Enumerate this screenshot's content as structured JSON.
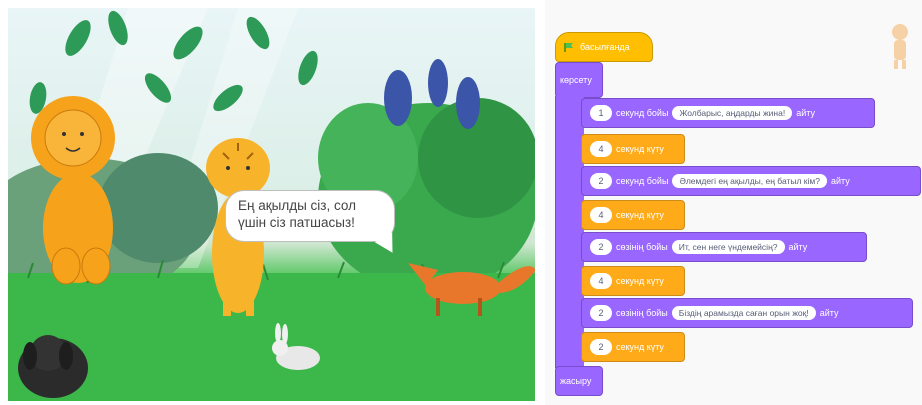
{
  "stage": {
    "bubble_text": "Ең ақылды сіз, сол үшін сіз патшасыз!"
  },
  "code": {
    "hat_label": "басылғанда",
    "say_label_a": "секунд бойы",
    "say_label_b": "сөзінің бойы",
    "say_suffix": "айту",
    "wait_label": "секунд күту",
    "blocks": [
      {
        "type": "repeat",
        "label": "көрсету"
      },
      {
        "type": "say",
        "num": "1",
        "text": "Жолбарыс, аңдарды жина!"
      },
      {
        "type": "wait",
        "num": "4"
      },
      {
        "type": "say",
        "num": "2",
        "text": "Әлемдегі ең ақылды, ең батыл кім?"
      },
      {
        "type": "wait",
        "num": "4"
      },
      {
        "type": "say",
        "num": "2",
        "text": "Ит, сен неге үндемейсің?"
      },
      {
        "type": "wait",
        "num": "4"
      },
      {
        "type": "say",
        "num": "2",
        "text": "Біздің арамызда саған орын жоқ!"
      },
      {
        "type": "wait",
        "num": "2"
      },
      {
        "type": "end",
        "label": "жасыру"
      }
    ]
  },
  "colors": {
    "events": "#ffbf00",
    "looks": "#9966ff",
    "control": "#ffab19",
    "grass": "#3fbf4c"
  }
}
